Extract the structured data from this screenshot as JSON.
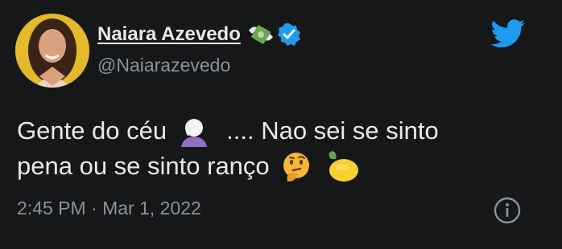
{
  "author": {
    "display_name": "Naiara Azevedo",
    "handle": "@Naiarazevedo",
    "badges": [
      "money-with-wings-icon",
      "verified-icon"
    ]
  },
  "tweet": {
    "text_part1": "Gente do céu",
    "text_part2": ".... Nao sei se sinto",
    "text_part3": "pena ou se sinto ranço",
    "emojis": [
      "face-palm-icon",
      "thinking-face-icon",
      "lemon-icon"
    ]
  },
  "meta": {
    "timestamp": "2:45 PM · Mar 1, 2022"
  },
  "colors": {
    "background": "#151719",
    "text": "#e7e9ea",
    "secondary": "#8b9298",
    "twitter_blue": "#1d9bf0"
  }
}
